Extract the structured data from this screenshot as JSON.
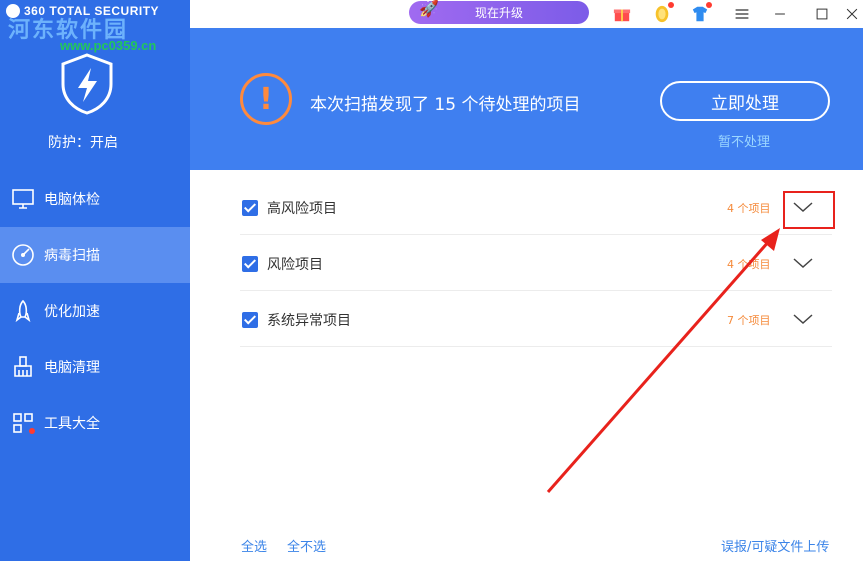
{
  "app": {
    "brand": "360 TOTAL SECURITY"
  },
  "watermark": {
    "line1": "河东软件园",
    "line2": "www.pc0359.cn"
  },
  "sidebar": {
    "status": "防护：开启",
    "items": [
      {
        "label": "电脑体检",
        "icon": "monitor-icon"
      },
      {
        "label": "病毒扫描",
        "icon": "scan-icon"
      },
      {
        "label": "优化加速",
        "icon": "rocket-icon"
      },
      {
        "label": "电脑清理",
        "icon": "broom-icon"
      },
      {
        "label": "工具大全",
        "icon": "grid-icon"
      }
    ]
  },
  "topbar": {
    "upgrade_label": "现在升级"
  },
  "header": {
    "message": "本次扫描发现了 15 个待处理的项目",
    "primary_button": "立即处理",
    "secondary_link": "暂不处理"
  },
  "list": {
    "rows": [
      {
        "label": "高风险项目",
        "count": "4 个项目"
      },
      {
        "label": "风险项目",
        "count": "4 个项目"
      },
      {
        "label": "系统异常项目",
        "count": "7 个项目"
      }
    ]
  },
  "footer": {
    "select_all": "全选",
    "select_none": "全不选",
    "report": "误报/可疑文件上传"
  },
  "colors": {
    "sidebar": "#2f6ee6",
    "header": "#3f7ff0",
    "warning": "#ff8a3d",
    "count": "#f58a3a",
    "link": "#3b84e8",
    "annotation": "#e8221c"
  }
}
